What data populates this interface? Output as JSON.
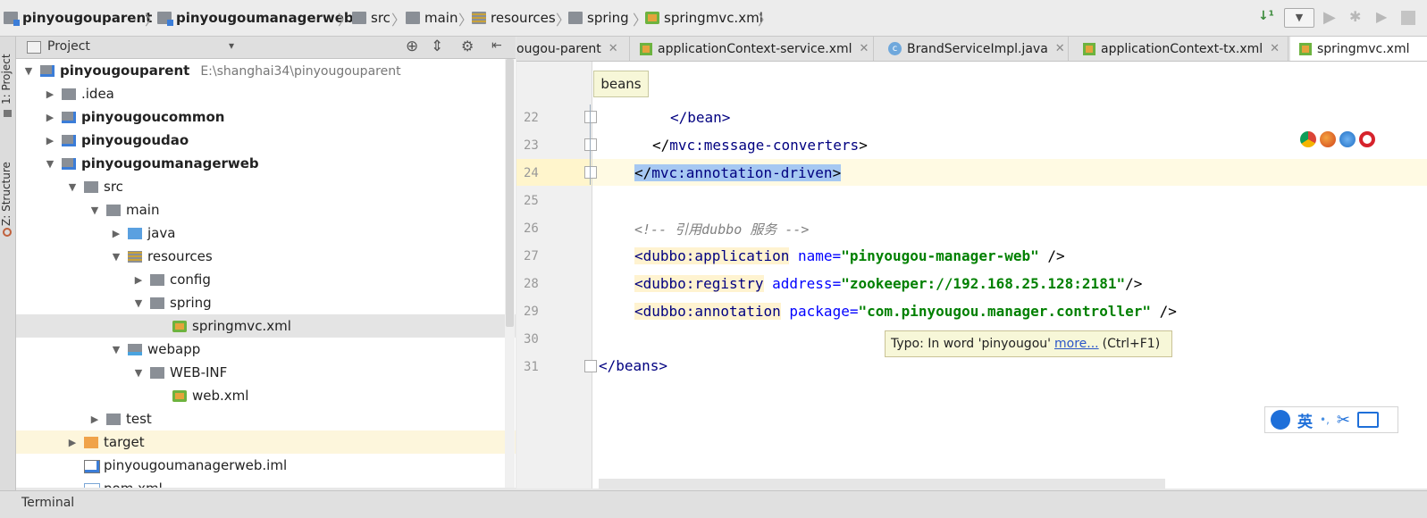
{
  "breadcrumb": [
    {
      "label": "pinyougouparent",
      "icon": "module-folder-icon",
      "bold": true
    },
    {
      "label": "pinyougoumanagerweb",
      "icon": "module-folder-icon",
      "bold": true
    },
    {
      "label": "src",
      "icon": "folder-icon"
    },
    {
      "label": "main",
      "icon": "folder-icon"
    },
    {
      "label": "resources",
      "icon": "resources-folder-icon"
    },
    {
      "label": "spring",
      "icon": "folder-icon"
    },
    {
      "label": "springmvc.xml",
      "icon": "spring-xml-file-icon"
    }
  ],
  "left_strip": {
    "project_tab": "1: Project",
    "structure_tab": "Z: Structure"
  },
  "project_pane": {
    "title": "Project",
    "dropdown": "▾"
  },
  "tree": [
    {
      "label": "pinyougouparent",
      "path": "E:\\shanghai34\\pinyougouparent",
      "level": 0,
      "arrow": "▼",
      "icon": "module-folder-icon",
      "bold": true
    },
    {
      "label": ".idea",
      "level": 1,
      "arrow": "▶",
      "icon": "folder-icon"
    },
    {
      "label": "pinyougoucommon",
      "level": 1,
      "arrow": "▶",
      "icon": "module-folder-icon",
      "bold": true
    },
    {
      "label": "pinyougoudao",
      "level": 1,
      "arrow": "▶",
      "icon": "module-folder-icon",
      "bold": true
    },
    {
      "label": "pinyougoumanagerweb",
      "level": 1,
      "arrow": "▼",
      "icon": "module-folder-icon",
      "bold": true
    },
    {
      "label": "src",
      "level": 2,
      "arrow": "▼",
      "icon": "folder-icon"
    },
    {
      "label": "main",
      "level": 3,
      "arrow": "▼",
      "icon": "folder-icon"
    },
    {
      "label": "java",
      "level": 4,
      "arrow": "▶",
      "icon": "source-folder-icon"
    },
    {
      "label": "resources",
      "level": 4,
      "arrow": "▼",
      "icon": "resources-folder-icon"
    },
    {
      "label": "config",
      "level": 5,
      "arrow": "▶",
      "icon": "folder-icon"
    },
    {
      "label": "spring",
      "level": 5,
      "arrow": "▼",
      "icon": "folder-icon"
    },
    {
      "label": "springmvc.xml",
      "level": 6,
      "arrow": "",
      "icon": "spring-xml-file-icon",
      "selected": true
    },
    {
      "label": "webapp",
      "level": 4,
      "arrow": "▼",
      "icon": "web-folder-icon"
    },
    {
      "label": "WEB-INF",
      "level": 5,
      "arrow": "▼",
      "icon": "folder-icon"
    },
    {
      "label": "web.xml",
      "level": 6,
      "arrow": "",
      "icon": "xml-file-icon"
    },
    {
      "label": "test",
      "level": 3,
      "arrow": "▶",
      "icon": "folder-icon"
    },
    {
      "label": "target",
      "level": 2,
      "arrow": "▶",
      "icon": "excluded-folder-icon",
      "highlight": true
    },
    {
      "label": "pinyougoumanagerweb.iml",
      "level": 2,
      "arrow": "",
      "icon": "iml-file-icon"
    },
    {
      "label": "pom.xml",
      "level": 2,
      "arrow": "",
      "icon": "maven-file-icon"
    }
  ],
  "tabs": [
    {
      "label": "ougou-parent",
      "icon": ""
    },
    {
      "label": "applicationContext-service.xml",
      "icon": "spring-xml-file-icon"
    },
    {
      "label": "BrandServiceImpl.java",
      "icon": "class-icon"
    },
    {
      "label": "applicationContext-tx.xml",
      "icon": "spring-xml-file-icon"
    },
    {
      "label": "springmvc.xml",
      "icon": "spring-xml-file-icon",
      "active": true
    }
  ],
  "tab_close": "✕",
  "editor": {
    "breadcrumb_tooltip": "beans",
    "line_numbers": [
      "22",
      "23",
      "24",
      "25",
      "26",
      "27",
      "28",
      "29",
      "30",
      "31"
    ],
    "lines": {
      "l22_tag": "</bean>",
      "l23_open": "</",
      "l23_tag": "mvc:message-converters",
      "l23_close": ">",
      "l24_open": "</",
      "l24_tag": "mvc:annotation-driven",
      "l24_close": ">",
      "l26_comment": "<!-- 引用dubbo 服务 -->",
      "l27_tag": "<dubbo:application",
      "l27_attr": " name=",
      "l27_val": "\"pinyougou-manager-web\"",
      "l27_end": " />",
      "l28_tag": "<dubbo:registry",
      "l28_attr": " address=",
      "l28_val": "\"zookeeper://192.168.25.128:2181\"",
      "l28_end": "/>",
      "l29_tag": "<dubbo:annotation",
      "l29_attr": " package=",
      "l29_val": "\"com.pinyougou.manager.controller\"",
      "l29_end": " />",
      "l31_tag": "</beans>"
    },
    "typo_tooltip": {
      "text": "Typo: In word 'pinyougou'",
      "link": "more...",
      "shortcut": "(Ctrl+F1)"
    }
  },
  "ime": {
    "lang": "英",
    "punct": "•,"
  },
  "bottom": {
    "terminal": "Terminal"
  },
  "colors": {
    "selected_row": "#e4e4e4",
    "current_line": "#fffae3",
    "tag": "#000080",
    "attr": "#0000ff",
    "string": "#008000",
    "comment": "#808080",
    "typo_bg": "#f7f7d8"
  }
}
